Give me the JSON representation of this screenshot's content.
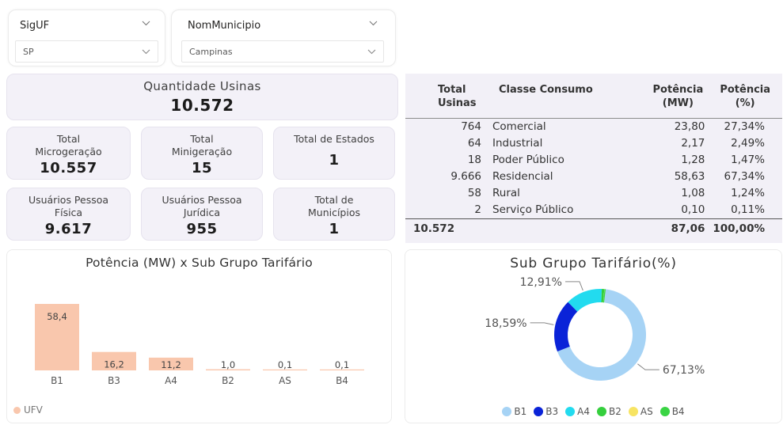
{
  "filters": {
    "uf": {
      "label": "SigUF",
      "value": "SP"
    },
    "municipio": {
      "label": "NomMunicipio",
      "value": "Campinas"
    }
  },
  "kpis": {
    "quantidade_usinas": {
      "label": "Quantidade Usinas",
      "value": "10.572"
    },
    "total_microgeracao": {
      "label_1": "Total",
      "label_2": "Microgeração",
      "value": "10.557"
    },
    "total_minigeracao": {
      "label_1": "Total",
      "label_2": "Minigeração",
      "value": "15"
    },
    "total_estados": {
      "label": "Total de Estados",
      "value": "1"
    },
    "usuarios_pf": {
      "label_1": "Usuários Pessoa",
      "label_2": "Física",
      "value": "9.617"
    },
    "usuarios_pj": {
      "label_1": "Usuários Pessoa",
      "label_2": "Jurídica",
      "value": "955"
    },
    "total_municipios": {
      "label_1": "Total de",
      "label_2": "Municípios",
      "value": "1"
    }
  },
  "table": {
    "headers": {
      "total_usinas": [
        "Total",
        "Usinas"
      ],
      "classe": "Classe Consumo",
      "potencia_mw": [
        "Potência",
        "(MW)"
      ],
      "potencia_pct": [
        "Potência",
        "(%)"
      ]
    },
    "rows": [
      {
        "total": "764",
        "classe": "Comercial",
        "mw": "23,80",
        "pct": "27,34%"
      },
      {
        "total": "64",
        "classe": "Industrial",
        "mw": "2,17",
        "pct": "2,49%"
      },
      {
        "total": "18",
        "classe": "Poder Público",
        "mw": "1,28",
        "pct": "1,47%"
      },
      {
        "total": "9.666",
        "classe": "Residencial",
        "mw": "58,63",
        "pct": "67,34%"
      },
      {
        "total": "58",
        "classe": "Rural",
        "mw": "1,08",
        "pct": "1,24%"
      },
      {
        "total": "2",
        "classe": "Serviço Público",
        "mw": "0,10",
        "pct": "0,11%"
      }
    ],
    "totals": {
      "total": "10.572",
      "mw": "87,06",
      "pct": "100,00%"
    }
  },
  "chart_data": [
    {
      "type": "bar",
      "title": "Potência (MW) x Sub Grupo Tarifário",
      "categories": [
        "B1",
        "B3",
        "A4",
        "B2",
        "AS",
        "B4"
      ],
      "values": [
        58.4,
        16.2,
        11.2,
        1.0,
        0.1,
        0.1
      ],
      "value_labels": [
        "58,4",
        "16,2",
        "11,2",
        "1,0",
        "0,1",
        "0,1"
      ],
      "series": [
        {
          "name": "UFV",
          "color": "#f9c7ad"
        }
      ],
      "legend": {
        "position": "bottom-left",
        "label": "UFV"
      }
    },
    {
      "type": "pie",
      "title": "Sub Grupo Tarifário(%)",
      "categories": [
        "B1",
        "B3",
        "A4",
        "B2",
        "AS",
        "B4"
      ],
      "values": [
        67.13,
        18.59,
        12.91,
        0.9,
        0.05,
        0.42
      ],
      "value_labels": [
        "67,13%",
        "18,59%",
        "12,91%"
      ],
      "colors": [
        "#a6d3f5",
        "#0a23d8",
        "#22dbef",
        "#35cf3d",
        "#f7e463",
        "#3ad444"
      ],
      "legend": {
        "position": "bottom",
        "labels": [
          "B1",
          "B3",
          "A4",
          "B2",
          "AS",
          "B4"
        ]
      }
    }
  ]
}
